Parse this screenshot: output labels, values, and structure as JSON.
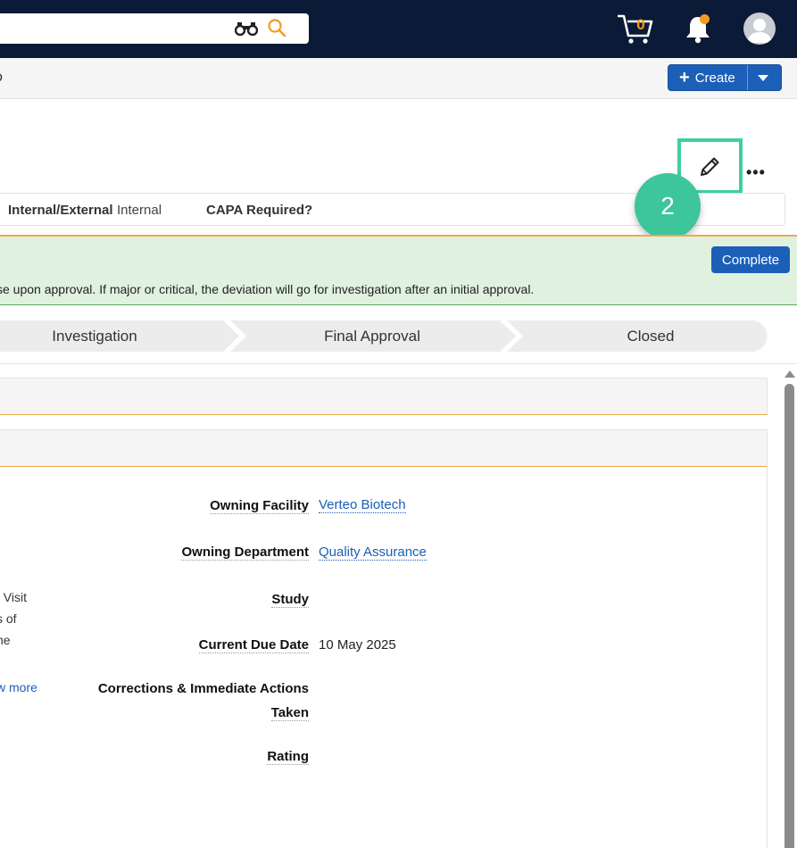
{
  "nav": {
    "cart_count": "0",
    "icons": [
      "binoculars-icon",
      "search-icon",
      "cart-icon",
      "bell-icon",
      "user-avatar-icon"
    ]
  },
  "subbar": {
    "title_fragment": "o",
    "create_label": "Create"
  },
  "record_header": {
    "fields": [
      {
        "label": "Internal/External",
        "value": "Internal"
      },
      {
        "label": "CAPA Required?",
        "value": ""
      }
    ],
    "step_badge": "2"
  },
  "banner": {
    "text": "se upon approval. If major or critical, the deviation will go for investigation after an initial approval.",
    "complete_label": "Complete"
  },
  "stages": [
    "Investigation",
    "Final Approval",
    "Closed"
  ],
  "details": {
    "owning_facility": {
      "label": "Owning Facility",
      "value": "Verteo Biotech"
    },
    "owning_department": {
      "label": "Owning Department",
      "value": "Quality Assurance"
    },
    "study": {
      "label": "Study",
      "value": ""
    },
    "current_due_date": {
      "label": "Current Due Date",
      "value": "10 May 2025"
    },
    "corrections": {
      "label_line1": "Corrections & Immediate Actions",
      "label_line2": "Taken",
      "value": ""
    },
    "rating": {
      "label": "Rating",
      "value": ""
    }
  },
  "left_column": {
    "line1": "t Visit",
    "line2": "s of",
    "line3": "he",
    "view_more": "w more"
  },
  "colors": {
    "nav_bg": "#0b1a36",
    "accent_orange": "#f29b1e",
    "primary_blue": "#1c5fb8",
    "banner_green": "#e0f1e0",
    "highlight_teal": "#3fcfa2"
  }
}
